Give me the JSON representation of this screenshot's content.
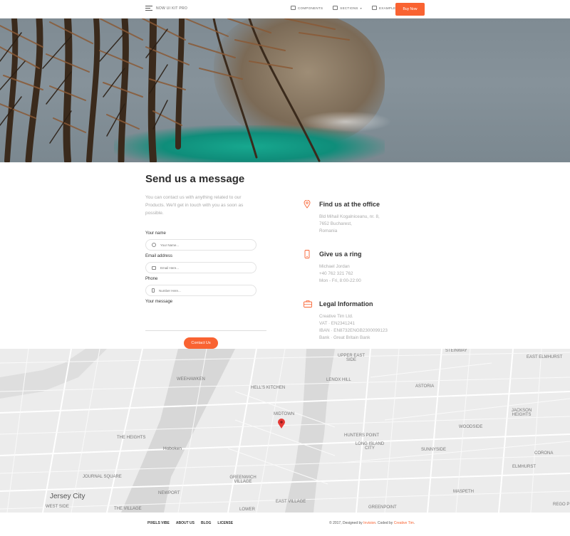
{
  "nav": {
    "brand": "Now UI Kit Pro",
    "links": [
      {
        "label": "Components",
        "icon": "layers-icon"
      },
      {
        "label": "Sections",
        "icon": "sections-icon",
        "caret": "▾"
      },
      {
        "label": "Examples",
        "icon": "examples-icon",
        "caret": "▾"
      }
    ],
    "buy_label": "Buy Now"
  },
  "contact": {
    "title": "Send us a message",
    "description": "You can contact us with anything related to our Products. We'll get in touch with you as soon as possible.",
    "fields": {
      "name_label": "Your name",
      "name_placeholder": "Your Name...",
      "email_label": "Email address",
      "email_placeholder": "Email Here...",
      "phone_label": "Phone",
      "phone_placeholder": "Number Here...",
      "message_label": "Your message"
    },
    "submit_label": "Contact Us"
  },
  "info": {
    "office": {
      "title": "Find us at the office",
      "lines": [
        "Bld Mihail Kogalniceanu, nr. 8,",
        "7652 Bucharest,",
        "Romania"
      ]
    },
    "ring": {
      "title": "Give us a ring",
      "lines": [
        "Michael Jordan",
        "+40 762 321 762",
        "Mon - Fri, 8:00-22:00"
      ]
    },
    "legal": {
      "title": "Legal Information",
      "lines": [
        "Creative Tim Ltd.",
        "VAT · EN2341241",
        "IBAN · EN8732ENGB2300099123",
        "Bank · Great Britain Bank"
      ]
    }
  },
  "map": {
    "labels": {
      "weehawken": "Weehawken",
      "hells_kitchen": "Hell's Kitchen",
      "upper_east": "Upper East Side",
      "lenox_hill": "Lenox Hill",
      "midtown": "Midtown",
      "astoria": "Astoria",
      "steinway": "Steinway",
      "east_elmhurst": "East Elmhurst",
      "jackson_heights": "Jackson Heights",
      "woodside": "Woodside",
      "hunters_point": "Hunters Point",
      "long_island_city": "Long Island City",
      "sunnyside": "Sunnyside",
      "corona": "Corona",
      "elmhurst": "Elmhurst",
      "the_heights": "The Heights",
      "hoboken": "Hoboken",
      "journal_square": "Journal Square",
      "jersey_city": "Jersey City",
      "west_side": "West Side",
      "newport": "Newport",
      "the_village": "The Village",
      "greenwich_village": "Greenwich Village",
      "east_village": "East Village",
      "lower": "Lower",
      "greenpoint": "Greenpoint",
      "maspeth": "Maspeth",
      "rego_park": "Rego P"
    }
  },
  "footer": {
    "links": [
      "Pixels Vibe",
      "About Us",
      "Blog",
      "License"
    ],
    "copy_prefix": "© 2017, Designed by",
    "designer": "Invision",
    "copy_mid": ". Coded by",
    "coder": "Creative Tim",
    "copy_suffix": "."
  },
  "colors": {
    "accent": "#f96332"
  }
}
